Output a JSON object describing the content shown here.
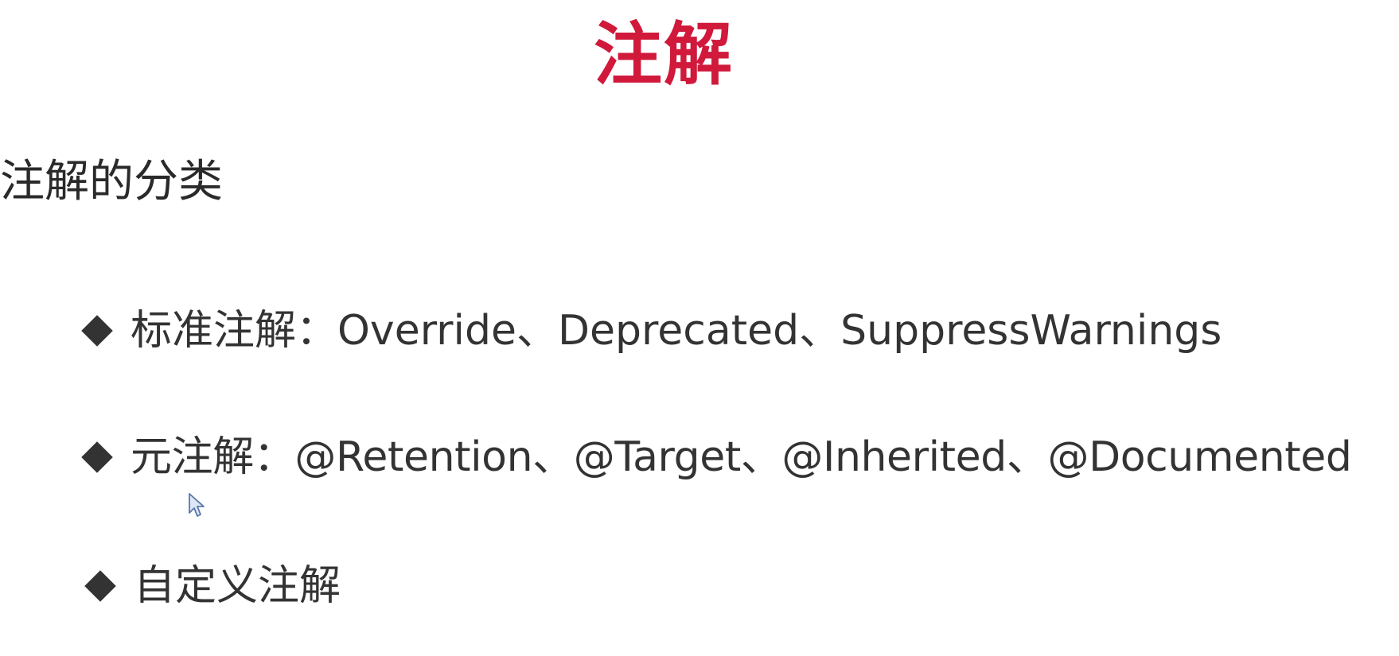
{
  "slide": {
    "title": "注解",
    "title_color": "#d0193b",
    "section_heading": "注解的分类",
    "bullets": [
      {
        "text": "标准注解：Override、Deprecated、SuppressWarnings"
      },
      {
        "text": "元注解：@Retention、@Target、@Inherited、@Documented"
      },
      {
        "text": "自定义注解"
      }
    ],
    "bullet_icon": "diamond-bullet-icon",
    "cursor_icon": "mouse-pointer-icon"
  }
}
